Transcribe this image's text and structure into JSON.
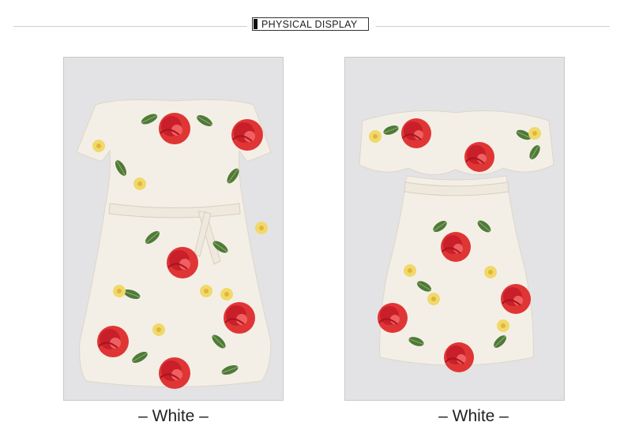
{
  "section_title": "PHYSICAL DISPLAY",
  "products": [
    {
      "caption": "– White –",
      "color": "#f4efe6",
      "view": "front-off-shoulder"
    },
    {
      "caption": "– White –",
      "color": "#f4efe6",
      "view": "ruffle-off-shoulder"
    }
  ],
  "colors": {
    "background_panel": "#e3e3e5",
    "rose": "#e03535",
    "leaf": "#4f7a3a",
    "yellow": "#f0d96a"
  }
}
